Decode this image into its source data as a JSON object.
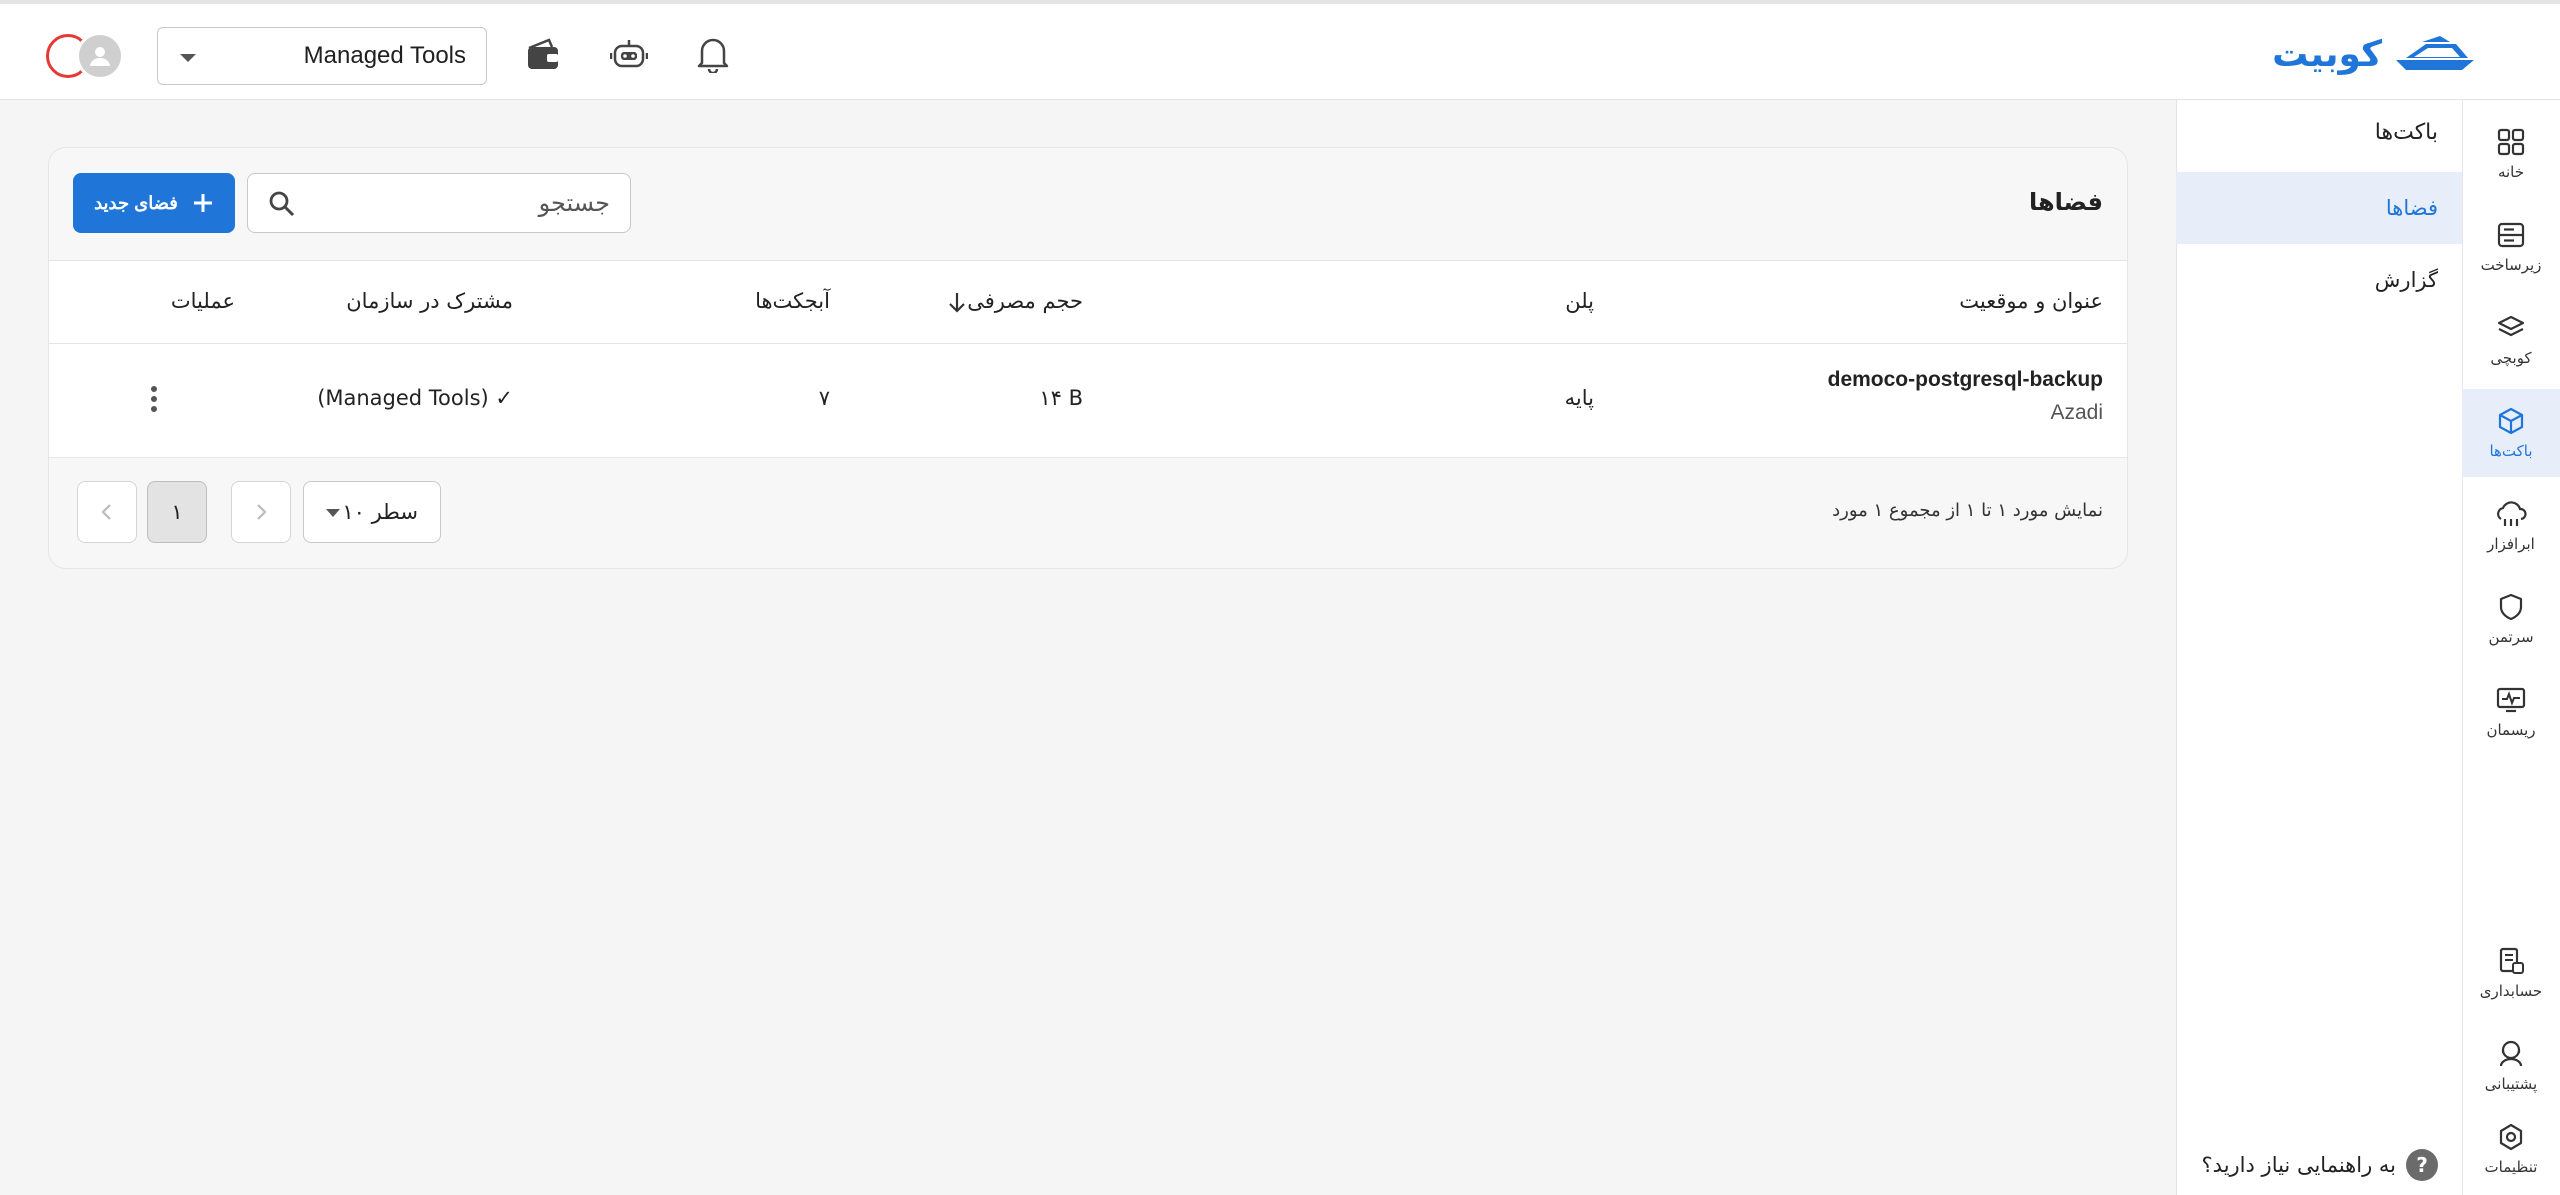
{
  "header": {
    "brand": "کوبیت",
    "org_selector": {
      "value": "Managed Tools"
    },
    "icons": [
      "bell-icon",
      "robot-icon",
      "wallet-icon"
    ]
  },
  "rail": {
    "items": [
      {
        "label": "خانه",
        "icon": "grid-icon"
      },
      {
        "label": "زیرساخت",
        "icon": "server-icon"
      },
      {
        "label": "کوبچی",
        "icon": "layers-icon"
      },
      {
        "label": "باکت‌ها",
        "icon": "cube-icon",
        "active": true
      },
      {
        "label": "ابرافزار",
        "icon": "cloud-app-icon"
      },
      {
        "label": "سرتمن",
        "icon": "shield-icon"
      },
      {
        "label": "ریسمان",
        "icon": "monitor-icon"
      },
      {
        "label": "حسابداری",
        "icon": "receipt-icon"
      },
      {
        "label": "پشتیبانی",
        "icon": "support-icon"
      },
      {
        "label": "تنظیمات",
        "icon": "settings-icon"
      }
    ]
  },
  "subnav": {
    "title": "باکت‌ها",
    "items": [
      {
        "label": "فضاها",
        "active": true
      },
      {
        "label": "گزارش"
      }
    ],
    "help": "به راهنمایی نیاز دارید؟"
  },
  "main": {
    "title": "فضاها",
    "search_placeholder": "جستجو",
    "new_button": "فضای جدید",
    "columns": {
      "title_location": "عنوان و موقعیت",
      "plan": "پلن",
      "usage": "حجم مصرفی",
      "objects": "آبجکت‌ها",
      "shared": "مشترک در سازمان",
      "actions": "عملیات"
    },
    "rows": [
      {
        "name": "democo-postgresql-backup",
        "location": "Azadi",
        "plan": "پایه",
        "usage": "۱۴ B",
        "objects": "۷",
        "shared": "(Managed Tools) ✓"
      }
    ],
    "footer": {
      "range_text": "نمایش مورد ۱ تا ۱ از مجموع ۱ مورد",
      "rows_per_page": "۱۰ سطر",
      "current_page": "۱"
    }
  },
  "colors": {
    "accent": "#1f76d8",
    "active_bg": "#e7eefa"
  }
}
